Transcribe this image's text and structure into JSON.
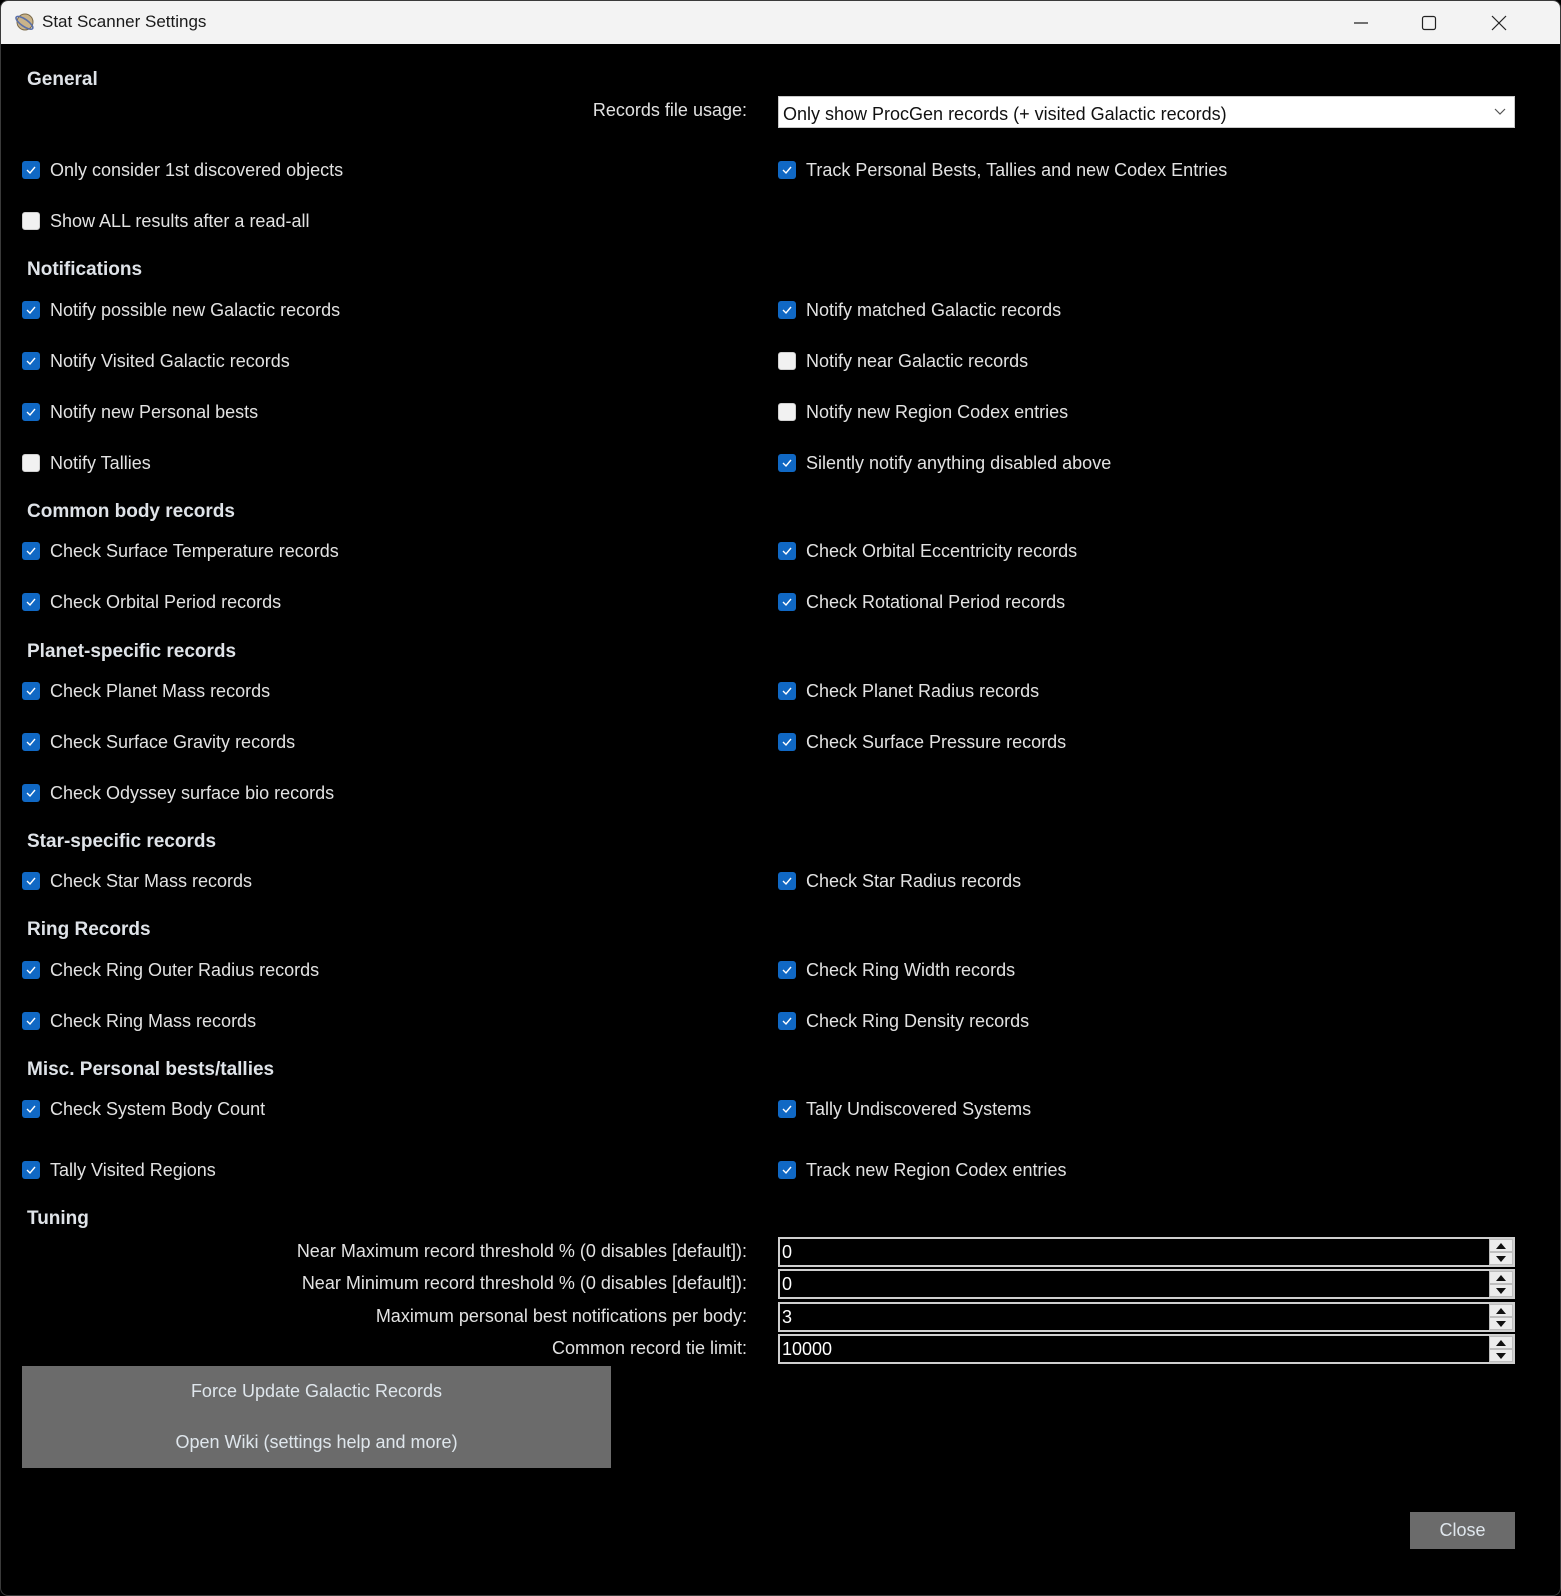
{
  "window": {
    "title": "Stat Scanner Settings",
    "controls": [
      "minimize",
      "maximize",
      "close"
    ]
  },
  "sections": {
    "general": "General",
    "notifications": "Notifications",
    "common": "Common body records",
    "planet": "Planet-specific records",
    "star": "Star-specific records",
    "ring": "Ring Records",
    "misc": "Misc. Personal bests/tallies",
    "tuning": "Tuning"
  },
  "general": {
    "records_file_label": "Records file usage:",
    "records_file_value": "Only show ProcGen records (+ visited Galactic records)",
    "checks": [
      {
        "label": "Only consider 1st discovered objects",
        "checked": true
      },
      {
        "label": "Track Personal Bests, Tallies and new Codex Entries",
        "checked": true
      },
      {
        "label": "Show ALL results after a read-all",
        "checked": false
      }
    ]
  },
  "notifications": [
    {
      "label": "Notify possible new Galactic records",
      "checked": true
    },
    {
      "label": "Notify matched Galactic records",
      "checked": true
    },
    {
      "label": "Notify Visited Galactic records",
      "checked": true
    },
    {
      "label": "Notify near Galactic records",
      "checked": false
    },
    {
      "label": "Notify new Personal bests",
      "checked": true
    },
    {
      "label": "Notify new Region Codex entries",
      "checked": false
    },
    {
      "label": "Notify Tallies",
      "checked": false
    },
    {
      "label": "Silently notify anything disabled above",
      "checked": true
    }
  ],
  "common": [
    {
      "label": "Check Surface Temperature records",
      "checked": true
    },
    {
      "label": "Check Orbital Eccentricity records",
      "checked": true
    },
    {
      "label": "Check Orbital Period records",
      "checked": true
    },
    {
      "label": "Check Rotational Period records",
      "checked": true
    }
  ],
  "planet": [
    {
      "label": "Check Planet Mass records",
      "checked": true
    },
    {
      "label": "Check Planet Radius records",
      "checked": true
    },
    {
      "label": "Check Surface Gravity records",
      "checked": true
    },
    {
      "label": "Check Surface Pressure records",
      "checked": true
    },
    {
      "label": "Check Odyssey surface bio records",
      "checked": true
    }
  ],
  "star": [
    {
      "label": "Check Star Mass records",
      "checked": true
    },
    {
      "label": "Check Star Radius records",
      "checked": true
    }
  ],
  "ring": [
    {
      "label": "Check Ring Outer Radius records",
      "checked": true
    },
    {
      "label": "Check Ring Width records",
      "checked": true
    },
    {
      "label": "Check Ring Mass records",
      "checked": true
    },
    {
      "label": "Check Ring Density records",
      "checked": true
    }
  ],
  "misc": [
    {
      "label": "Check System Body Count",
      "checked": true
    },
    {
      "label": "Tally Undiscovered Systems",
      "checked": true
    },
    {
      "label": "Tally Visited Regions",
      "checked": true
    },
    {
      "label": "Track new Region Codex entries",
      "checked": true
    }
  ],
  "tuning": [
    {
      "label": "Near Maximum record threshold % (0 disables [default]):",
      "value": "0"
    },
    {
      "label": "Near Minimum record threshold % (0 disables [default]):",
      "value": "0"
    },
    {
      "label": "Maximum personal best notifications per body:",
      "value": "3"
    },
    {
      "label": "Common record tie limit:",
      "value": "10000"
    }
  ],
  "buttons": {
    "force_update": "Force Update Galactic Records",
    "open_wiki": "Open Wiki (settings help and more)",
    "close": "Close"
  },
  "colors": {
    "accent": "#1068c4",
    "background": "#000000",
    "button_grey": "#6b6b6b",
    "titlebar": "#f3f3f3"
  }
}
